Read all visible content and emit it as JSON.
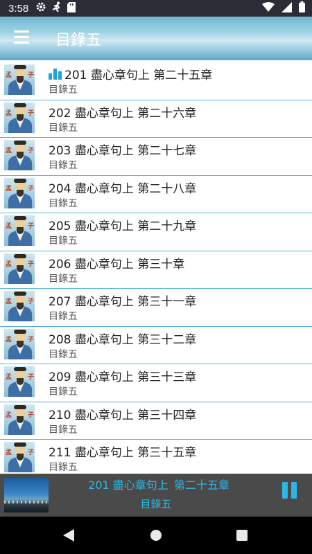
{
  "status_bar": {
    "time": "3:58",
    "icons_left": [
      "gear-icon",
      "runner-icon",
      "sd-card-icon"
    ],
    "icons_right": [
      "wifi-icon",
      "signal-icon",
      "battery-icon"
    ]
  },
  "app_bar": {
    "title": "目錄五",
    "menu_icon": "hamburger-menu-icon"
  },
  "tracks": [
    {
      "title": "201 盡心章句上 第二十五章",
      "subtitle": "目錄五",
      "playing": true
    },
    {
      "title": "202 盡心章句上 第二十六章",
      "subtitle": "目錄五",
      "playing": false
    },
    {
      "title": "203 盡心章句上 第二十七章",
      "subtitle": "目錄五",
      "playing": false
    },
    {
      "title": "204 盡心章句上 第二十八章",
      "subtitle": "目錄五",
      "playing": false
    },
    {
      "title": "205 盡心章句上 第二十九章",
      "subtitle": "目錄五",
      "playing": false
    },
    {
      "title": "206 盡心章句上 第三十章",
      "subtitle": "目錄五",
      "playing": false
    },
    {
      "title": "207 盡心章句上 第三十一章",
      "subtitle": "目錄五",
      "playing": false
    },
    {
      "title": "208 盡心章句上 第三十二章",
      "subtitle": "目錄五",
      "playing": false
    },
    {
      "title": "209 盡心章句上 第三十三章",
      "subtitle": "目錄五",
      "playing": false
    },
    {
      "title": "210 盡心章句上 第三十四章",
      "subtitle": "目錄五",
      "playing": false
    },
    {
      "title": "211 盡心章句上 第三十五章",
      "subtitle": "目錄五",
      "playing": false
    }
  ],
  "thumbnail": {
    "chars": [
      "孟",
      "子"
    ]
  },
  "now_playing": {
    "title": "201 盡心章句上",
    "chapter": "第二十五章",
    "subtitle": "目錄五",
    "pause_icon": "pause-icon"
  },
  "colors": {
    "accent": "#2bb7e6",
    "divider": "#55b6d6",
    "player_bg": "#4a4a4a",
    "status_bar_bg": "#2a2d36"
  }
}
